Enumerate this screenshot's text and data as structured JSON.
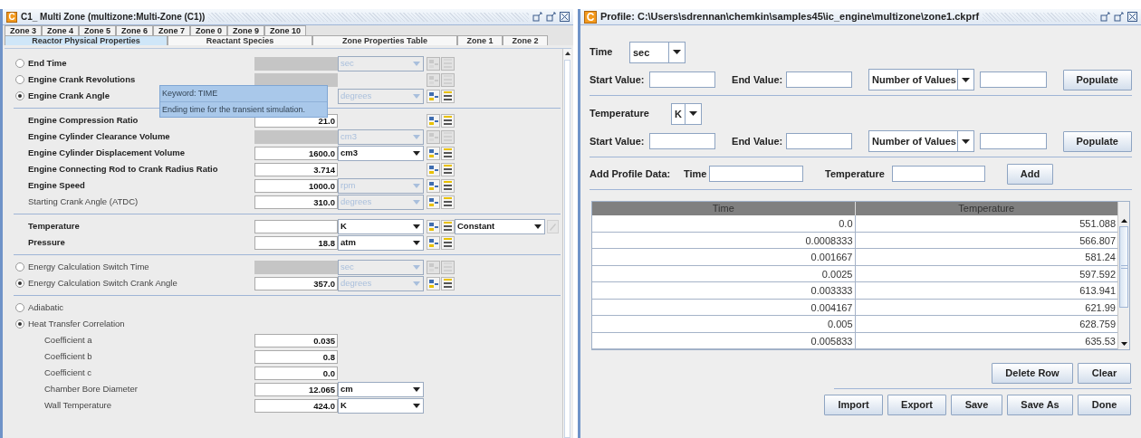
{
  "left_window": {
    "logo": "C",
    "title": "C1_ Multi Zone  (multizone:Multi-Zone (C1))",
    "zone_tabs": [
      {
        "label": "Zone 3",
        "selected": false
      },
      {
        "label": "Zone 4",
        "selected": false
      },
      {
        "label": "Zone 5",
        "selected": false
      },
      {
        "label": "Zone 6",
        "selected": false
      },
      {
        "label": "Zone 7",
        "selected": false
      },
      {
        "label": "Zone 0",
        "selected": false
      },
      {
        "label": "Zone 9",
        "selected": false
      },
      {
        "label": "Zone 10",
        "selected": false
      }
    ],
    "page_tabs": [
      {
        "label": "Reactor Physical Properties",
        "selected": true
      },
      {
        "label": "Reactant Species",
        "selected": false
      },
      {
        "label": "Zone Properties Table",
        "selected": false
      },
      {
        "label": "Zone 1",
        "selected": false
      },
      {
        "label": "Zone 2",
        "selected": false
      }
    ],
    "sections": [
      {
        "rows": [
          {
            "kind": "radio",
            "label": "End Time",
            "bold": true,
            "selected": false,
            "field": {
              "disabled": true
            },
            "unit": {
              "value": "sec",
              "disabled": true
            },
            "tools_disabled": true
          },
          {
            "kind": "radio",
            "label": "Engine Crank Revolutions",
            "bold": true,
            "selected": false,
            "field": {
              "disabled": true
            },
            "tools_disabled": true
          },
          {
            "kind": "radio",
            "label": "Engine Crank Angle",
            "bold": true,
            "selected": true,
            "unit": {
              "value": "degrees",
              "disabled": true
            },
            "tools_disabled": false
          }
        ]
      },
      {
        "rows": [
          {
            "kind": "field",
            "label": "Engine Compression Ratio",
            "bold": true,
            "field": {
              "value": "21.0",
              "disabled": false
            },
            "tools_disabled": false
          },
          {
            "kind": "field",
            "label": "Engine Cylinder Clearance Volume",
            "bold": true,
            "field": {
              "disabled": true
            },
            "unit": {
              "value": "cm3",
              "disabled": true
            },
            "tools_disabled": true
          },
          {
            "kind": "field",
            "label": "Engine Cylinder Displacement Volume",
            "bold": true,
            "field": {
              "value": "1600.0",
              "disabled": false
            },
            "unit": {
              "value": "cm3",
              "disabled": false
            },
            "tools_disabled": false
          },
          {
            "kind": "field",
            "label": "Engine Connecting Rod to Crank Radius Ratio",
            "bold": true,
            "field": {
              "value": "3.714",
              "disabled": false
            },
            "tools_disabled": false
          },
          {
            "kind": "field",
            "label": "Engine Speed",
            "bold": true,
            "field": {
              "value": "1000.0",
              "disabled": false
            },
            "unit": {
              "value": "rpm",
              "disabled": true
            },
            "tools_disabled": false
          },
          {
            "kind": "field",
            "label": "Starting Crank Angle (ATDC)",
            "bold": false,
            "field": {
              "value": "310.0",
              "disabled": false
            },
            "unit": {
              "value": "degrees",
              "disabled": true
            },
            "tools_disabled": false
          }
        ]
      },
      {
        "rows": [
          {
            "kind": "field",
            "label": "Temperature",
            "bold": true,
            "field": {
              "disabled": false
            },
            "unit": {
              "value": "K",
              "disabled": false
            },
            "tools_disabled": false,
            "mode": {
              "value": "Constant",
              "edit_disabled": true
            }
          },
          {
            "kind": "field",
            "label": "Pressure",
            "bold": true,
            "field": {
              "value": "18.8",
              "disabled": false
            },
            "unit": {
              "value": "atm",
              "disabled": false
            },
            "tools_disabled": false
          }
        ]
      },
      {
        "rows": [
          {
            "kind": "radio",
            "label": "Energy Calculation Switch Time",
            "bold": false,
            "selected": false,
            "field": {
              "disabled": true
            },
            "unit": {
              "value": "sec",
              "disabled": true
            },
            "tools_disabled": true
          },
          {
            "kind": "radio",
            "label": "Energy Calculation Switch Crank Angle",
            "bold": false,
            "selected": true,
            "field": {
              "value": "357.0",
              "disabled": false
            },
            "unit": {
              "value": "degrees",
              "disabled": true
            },
            "tools_disabled": false
          }
        ]
      },
      {
        "rows": [
          {
            "kind": "radio",
            "label": "Adiabatic",
            "bold": false,
            "selected": false
          },
          {
            "kind": "radio",
            "label": "Heat Transfer Correlation",
            "bold": false,
            "selected": true,
            "children": [
              {
                "kind": "field",
                "label": "Coefficient a",
                "bold": false,
                "field": {
                  "value": "0.035",
                  "disabled": false
                }
              },
              {
                "kind": "field",
                "label": "Coefficient b",
                "bold": false,
                "field": {
                  "value": "0.8",
                  "disabled": false
                }
              },
              {
                "kind": "field",
                "label": "Coefficient c",
                "bold": false,
                "field": {
                  "value": "0.0",
                  "disabled": false
                }
              },
              {
                "kind": "field",
                "label": "Chamber Bore Diameter",
                "bold": false,
                "field": {
                  "value": "12.065",
                  "disabled": false
                },
                "unit": {
                  "value": "cm",
                  "disabled": false
                }
              },
              {
                "kind": "field",
                "label": "Wall Temperature",
                "bold": false,
                "field": {
                  "value": "424.0",
                  "disabled": false
                },
                "unit": {
                  "value": "K",
                  "disabled": false
                }
              }
            ]
          }
        ]
      }
    ],
    "tooltip": {
      "lines": [
        "Keyword: TIME",
        "Ending time for the transient simulation."
      ]
    }
  },
  "right_window": {
    "logo": "C",
    "title": "Profile:  C:\\Users\\sdrennan\\chemkin\\samples45\\ic_engine\\multizone\\zone1.ckprf",
    "ranges": [
      {
        "label": "Time",
        "unit": "sec",
        "start_label": "Start Value:",
        "end_label": "End Value:",
        "count_mode": "Number of Values",
        "button": "Populate"
      },
      {
        "label": "Temperature",
        "unit": "K",
        "start_label": "Start Value:",
        "end_label": "End Value:",
        "count_mode": "Number of Values",
        "button": "Populate"
      }
    ],
    "add_row": {
      "label": "Add Profile Data:",
      "time_label": "Time",
      "temperature_label": "Temperature",
      "button": "Add"
    },
    "table": {
      "columns": [
        "Time",
        "Temperature"
      ],
      "rows": [
        [
          "0.0",
          "551.088"
        ],
        [
          "0.0008333",
          "566.807"
        ],
        [
          "0.001667",
          "581.24"
        ],
        [
          "0.0025",
          "597.592"
        ],
        [
          "0.003333",
          "613.941"
        ],
        [
          "0.004167",
          "621.99"
        ],
        [
          "0.005",
          "628.759"
        ],
        [
          "0.005833",
          "635.53"
        ]
      ]
    },
    "row_buttons": [
      "Delete Row",
      "Clear"
    ],
    "footer_buttons": [
      "Import",
      "Export",
      "Save",
      "Save As",
      "Done"
    ]
  }
}
